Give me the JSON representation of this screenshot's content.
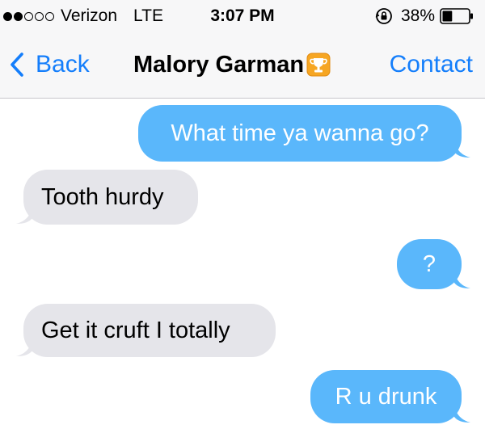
{
  "status_bar": {
    "signal_filled": 2,
    "signal_total": 5,
    "carrier": "Verizon",
    "network": "LTE",
    "time": "3:07 PM",
    "battery_percent": "38%",
    "battery_level": 0.38
  },
  "nav_bar": {
    "back_label": "Back",
    "title": "Malory Garman",
    "contact_label": "Contact",
    "title_emoji_icon": "trophy-emoji-icon"
  },
  "colors": {
    "accent": "#147efb",
    "sent_bubble": "#5ab7fb",
    "received_bubble": "#e5e5ea",
    "bar_background": "#f7f7f8"
  },
  "messages": [
    {
      "direction": "sent",
      "text": "What time ya wanna go?"
    },
    {
      "direction": "received",
      "text": "Tooth hurdy"
    },
    {
      "direction": "sent",
      "text": "?"
    },
    {
      "direction": "received",
      "text": "Get it cruft I totally"
    },
    {
      "direction": "sent",
      "text": "R u drunk"
    }
  ]
}
